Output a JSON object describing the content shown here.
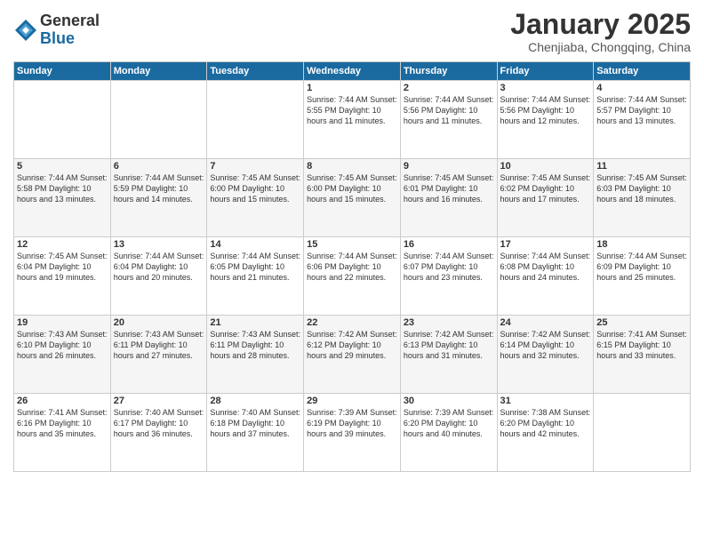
{
  "logo": {
    "general": "General",
    "blue": "Blue"
  },
  "title": "January 2025",
  "location": "Chenjiaba, Chongqing, China",
  "headers": [
    "Sunday",
    "Monday",
    "Tuesday",
    "Wednesday",
    "Thursday",
    "Friday",
    "Saturday"
  ],
  "weeks": [
    [
      {
        "day": "",
        "info": ""
      },
      {
        "day": "",
        "info": ""
      },
      {
        "day": "",
        "info": ""
      },
      {
        "day": "1",
        "info": "Sunrise: 7:44 AM\nSunset: 5:55 PM\nDaylight: 10 hours\nand 11 minutes."
      },
      {
        "day": "2",
        "info": "Sunrise: 7:44 AM\nSunset: 5:56 PM\nDaylight: 10 hours\nand 11 minutes."
      },
      {
        "day": "3",
        "info": "Sunrise: 7:44 AM\nSunset: 5:56 PM\nDaylight: 10 hours\nand 12 minutes."
      },
      {
        "day": "4",
        "info": "Sunrise: 7:44 AM\nSunset: 5:57 PM\nDaylight: 10 hours\nand 13 minutes."
      }
    ],
    [
      {
        "day": "5",
        "info": "Sunrise: 7:44 AM\nSunset: 5:58 PM\nDaylight: 10 hours\nand 13 minutes."
      },
      {
        "day": "6",
        "info": "Sunrise: 7:44 AM\nSunset: 5:59 PM\nDaylight: 10 hours\nand 14 minutes."
      },
      {
        "day": "7",
        "info": "Sunrise: 7:45 AM\nSunset: 6:00 PM\nDaylight: 10 hours\nand 15 minutes."
      },
      {
        "day": "8",
        "info": "Sunrise: 7:45 AM\nSunset: 6:00 PM\nDaylight: 10 hours\nand 15 minutes."
      },
      {
        "day": "9",
        "info": "Sunrise: 7:45 AM\nSunset: 6:01 PM\nDaylight: 10 hours\nand 16 minutes."
      },
      {
        "day": "10",
        "info": "Sunrise: 7:45 AM\nSunset: 6:02 PM\nDaylight: 10 hours\nand 17 minutes."
      },
      {
        "day": "11",
        "info": "Sunrise: 7:45 AM\nSunset: 6:03 PM\nDaylight: 10 hours\nand 18 minutes."
      }
    ],
    [
      {
        "day": "12",
        "info": "Sunrise: 7:45 AM\nSunset: 6:04 PM\nDaylight: 10 hours\nand 19 minutes."
      },
      {
        "day": "13",
        "info": "Sunrise: 7:44 AM\nSunset: 6:04 PM\nDaylight: 10 hours\nand 20 minutes."
      },
      {
        "day": "14",
        "info": "Sunrise: 7:44 AM\nSunset: 6:05 PM\nDaylight: 10 hours\nand 21 minutes."
      },
      {
        "day": "15",
        "info": "Sunrise: 7:44 AM\nSunset: 6:06 PM\nDaylight: 10 hours\nand 22 minutes."
      },
      {
        "day": "16",
        "info": "Sunrise: 7:44 AM\nSunset: 6:07 PM\nDaylight: 10 hours\nand 23 minutes."
      },
      {
        "day": "17",
        "info": "Sunrise: 7:44 AM\nSunset: 6:08 PM\nDaylight: 10 hours\nand 24 minutes."
      },
      {
        "day": "18",
        "info": "Sunrise: 7:44 AM\nSunset: 6:09 PM\nDaylight: 10 hours\nand 25 minutes."
      }
    ],
    [
      {
        "day": "19",
        "info": "Sunrise: 7:43 AM\nSunset: 6:10 PM\nDaylight: 10 hours\nand 26 minutes."
      },
      {
        "day": "20",
        "info": "Sunrise: 7:43 AM\nSunset: 6:11 PM\nDaylight: 10 hours\nand 27 minutes."
      },
      {
        "day": "21",
        "info": "Sunrise: 7:43 AM\nSunset: 6:11 PM\nDaylight: 10 hours\nand 28 minutes."
      },
      {
        "day": "22",
        "info": "Sunrise: 7:42 AM\nSunset: 6:12 PM\nDaylight: 10 hours\nand 29 minutes."
      },
      {
        "day": "23",
        "info": "Sunrise: 7:42 AM\nSunset: 6:13 PM\nDaylight: 10 hours\nand 31 minutes."
      },
      {
        "day": "24",
        "info": "Sunrise: 7:42 AM\nSunset: 6:14 PM\nDaylight: 10 hours\nand 32 minutes."
      },
      {
        "day": "25",
        "info": "Sunrise: 7:41 AM\nSunset: 6:15 PM\nDaylight: 10 hours\nand 33 minutes."
      }
    ],
    [
      {
        "day": "26",
        "info": "Sunrise: 7:41 AM\nSunset: 6:16 PM\nDaylight: 10 hours\nand 35 minutes."
      },
      {
        "day": "27",
        "info": "Sunrise: 7:40 AM\nSunset: 6:17 PM\nDaylight: 10 hours\nand 36 minutes."
      },
      {
        "day": "28",
        "info": "Sunrise: 7:40 AM\nSunset: 6:18 PM\nDaylight: 10 hours\nand 37 minutes."
      },
      {
        "day": "29",
        "info": "Sunrise: 7:39 AM\nSunset: 6:19 PM\nDaylight: 10 hours\nand 39 minutes."
      },
      {
        "day": "30",
        "info": "Sunrise: 7:39 AM\nSunset: 6:20 PM\nDaylight: 10 hours\nand 40 minutes."
      },
      {
        "day": "31",
        "info": "Sunrise: 7:38 AM\nSunset: 6:20 PM\nDaylight: 10 hours\nand 42 minutes."
      },
      {
        "day": "",
        "info": ""
      }
    ]
  ]
}
